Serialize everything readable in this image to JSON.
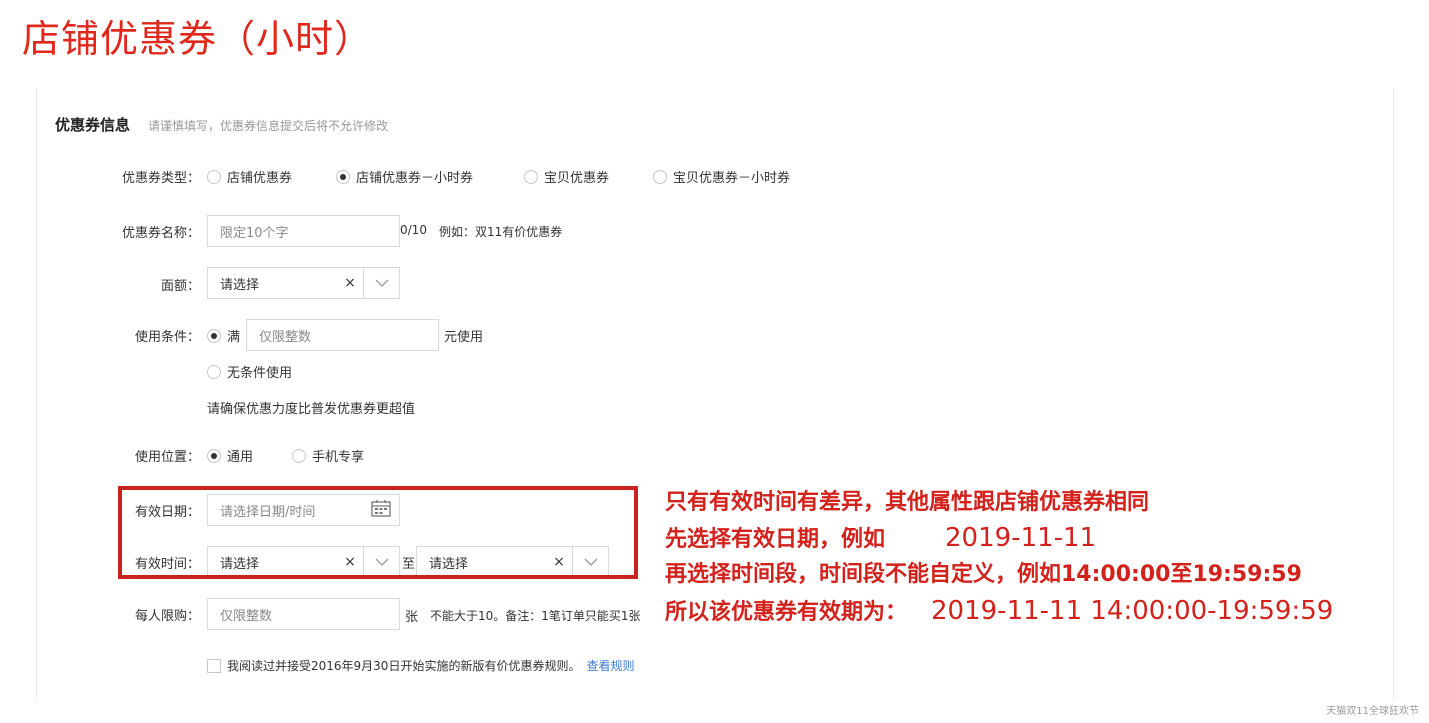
{
  "slide_title": "店铺优惠券（小时）",
  "section": {
    "title": "优惠券信息",
    "hint": "请谨慎填写，优惠券信息提交后将不允许修改"
  },
  "coupon_type": {
    "label": "优惠券类型：",
    "options": [
      "店铺优惠券",
      "店铺优惠券－小时券",
      "宝贝优惠券",
      "宝贝优惠券－小时券"
    ],
    "selected_index": 1
  },
  "coupon_name": {
    "label": "优惠券名称：",
    "placeholder": "限定10个字",
    "counter": "0/10",
    "example": "例如：双11有价优惠券"
  },
  "face_value": {
    "label": "面额：",
    "value": "请选择",
    "clear": "×"
  },
  "use_condition": {
    "label": "使用条件：",
    "full_label": "满",
    "placeholder": "仅限整数",
    "suffix": "元使用",
    "no_condition_label": "无条件使用",
    "hint": "请确保优惠力度比普发优惠券更超值"
  },
  "use_location": {
    "label": "使用位置：",
    "options": [
      "通用",
      "手机专享"
    ],
    "selected_index": 0
  },
  "valid_date": {
    "label": "有效日期：",
    "placeholder": "请选择日期/时间"
  },
  "valid_time": {
    "label": "有效时间：",
    "start_value": "请选择",
    "separator": "至",
    "end_value": "请选择",
    "clear": "×"
  },
  "per_person_limit": {
    "label": "每人限购：",
    "placeholder": "仅限整数",
    "unit": "张",
    "note": "不能大于10。备注：1笔订单只能买1张"
  },
  "agreement": {
    "text": "我阅读过并接受2016年9月30日开始实施的新版有价优惠券规则。",
    "link": "查看规则"
  },
  "annotations": {
    "line1": "只有有效时间有差异，其他属性跟店铺优惠券相同",
    "line2_prefix": "先选择有效日期，例如",
    "line2_value": "2019-11-11",
    "line3": "再选择时间段，时间段不能自定义，例如14:00:00至19:59:59",
    "line4_prefix": "所以该优惠券有效期为：",
    "line4_value": "2019-11-11 14:00:00-19:59:59"
  },
  "watermark": "天猫双11全球狂欢节",
  "colors": {
    "accent_red": "#d3211b",
    "link_blue": "#3d7bd8"
  }
}
